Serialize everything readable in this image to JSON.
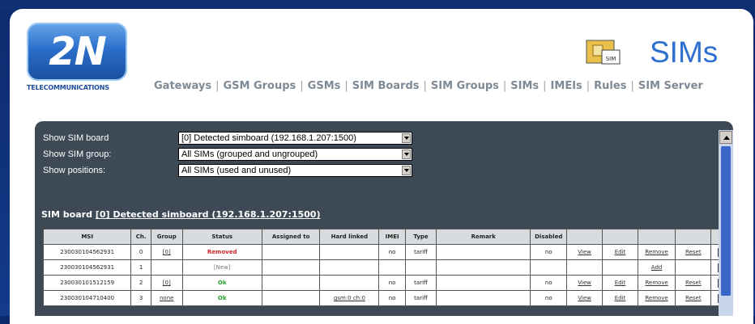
{
  "brand": {
    "logo_text": "2N",
    "subtitle": "TELECOMMUNICATIONS"
  },
  "page_title": "SIMs",
  "sim_icon_label": "SIM",
  "nav": [
    "Gateways",
    "GSM Groups",
    "GSMs",
    "SIM Boards",
    "SIM Groups",
    "SIMs",
    "IMEIs",
    "Rules",
    "SIM Server"
  ],
  "nav_separator": "|",
  "filters": [
    {
      "label": "Show SIM board",
      "value": "[0] Detected simboard (192.168.1.207:1500)"
    },
    {
      "label": "Show SIM group:",
      "value": "All SIMs (grouped and ungrouped)"
    },
    {
      "label": "Show positions:",
      "value": "All SIMs (used and unused)"
    }
  ],
  "board_heading": {
    "prefix": "SIM board",
    "link": "[0] Detected simboard (192.168.1.207:1500)"
  },
  "table": {
    "headers": [
      "MSI",
      "Ch.",
      "Group",
      "Status",
      "Assigned to",
      "Hard linked",
      "IMEI",
      "Type",
      "Remark",
      "Disabled",
      "",
      "",
      "",
      "",
      ""
    ],
    "rows": [
      {
        "msi": "230030104562931",
        "ch": "0",
        "group": "[0]",
        "status": "Removed",
        "status_class": "c-removed",
        "assigned": "",
        "hard": "",
        "imei": "no",
        "type": "tariff",
        "remark": "",
        "disabled": "no",
        "a1": "View",
        "a2": "Edit",
        "a3": "Remove",
        "a4": "Reset"
      },
      {
        "msi": "230030104562931",
        "ch": "1",
        "group": "",
        "status": "[New]",
        "status_class": "c-new",
        "assigned": "",
        "hard": "",
        "imei": "",
        "type": "",
        "remark": "",
        "disabled": "",
        "a1": "",
        "a2": "",
        "a3": "Add",
        "a4": ""
      },
      {
        "msi": "230030101512159",
        "ch": "2",
        "group": "[0]",
        "status": "Ok",
        "status_class": "c-ok",
        "assigned": "",
        "hard": "",
        "imei": "no",
        "type": "tariff",
        "remark": "",
        "disabled": "no",
        "a1": "View",
        "a2": "Edit",
        "a3": "Remove",
        "a4": "Reset"
      },
      {
        "msi": "230030104710400",
        "ch": "3",
        "group": "none",
        "status": "Ok",
        "status_class": "c-ok",
        "assigned": "",
        "hard": "gsm:0 ch:0",
        "imei": "no",
        "type": "tariff",
        "remark": "",
        "disabled": "no",
        "a1": "View",
        "a2": "Edit",
        "a3": "Remove",
        "a4": "Reset"
      }
    ]
  },
  "colors": {
    "accent": "#2f6fcf",
    "panel": "#3d4a55",
    "removed": "#d0262c",
    "ok": "#24a02b"
  }
}
